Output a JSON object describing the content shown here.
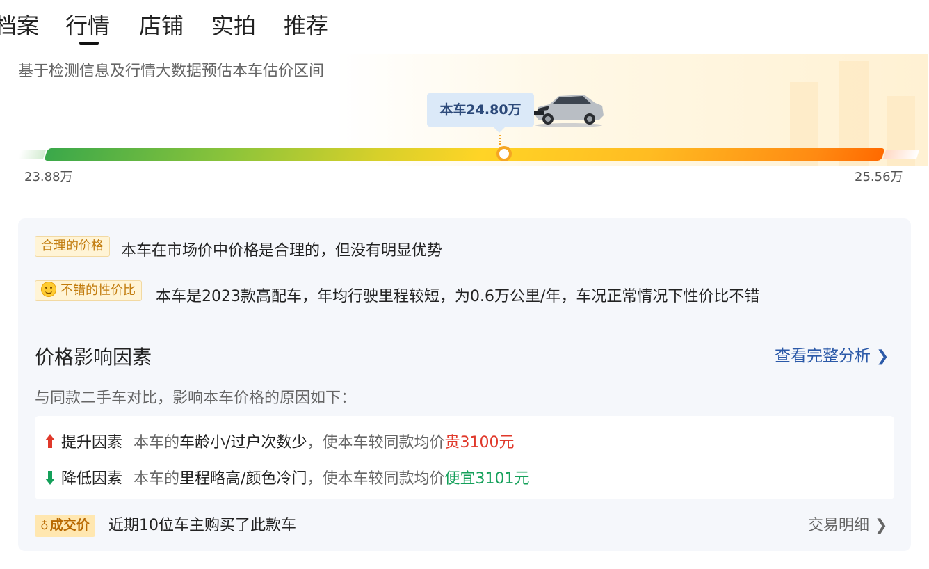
{
  "tabs": [
    {
      "label": "档案"
    },
    {
      "label": "行情"
    },
    {
      "label": "店铺"
    },
    {
      "label": "实拍"
    },
    {
      "label": "推荐"
    }
  ],
  "active_tab": "行情",
  "estimate": {
    "description": "基于检测信息及行情大数据预估本车估价区间",
    "current_price_label": "本车24.80万",
    "current_price_wan": 24.8,
    "min_price_label": "23.88万",
    "max_price_label": "25.56万",
    "min_price_wan": 23.88,
    "max_price_wan": 25.56
  },
  "assessments": [
    {
      "badge": "合理的价格",
      "text": "本车在市场价中价格是合理的，但没有明显优势"
    },
    {
      "badge": "不错的性价比",
      "text": "本车是2023款高配车，年均行驶里程较短，为0.6万公里/年，车况正常情况下性价比不错"
    }
  ],
  "factors": {
    "title": "价格影响因素",
    "link": "查看完整分析",
    "subtitle": "与同款二手车对比，影响本车价格的原因如下：",
    "increase": {
      "label": "提升因素",
      "prefix": "本车的",
      "reasons": "车龄小/过户次数少",
      "middle": "，使本车较同款均价",
      "result": "贵3100元"
    },
    "decrease": {
      "label": "降低因素",
      "prefix": "本车的",
      "reasons": "里程略高/颜色冷门",
      "middle": "，使本车较同款均价",
      "result": "便宜3101元"
    }
  },
  "deal": {
    "badge": "成交价",
    "text": "近期10位车主购买了此款车",
    "link": "交易明细"
  },
  "colors": {
    "accent_blue": "#2b59a8",
    "increase_red": "#e0392b",
    "decrease_green": "#14a05a",
    "marker_orange": "#f5a623"
  }
}
